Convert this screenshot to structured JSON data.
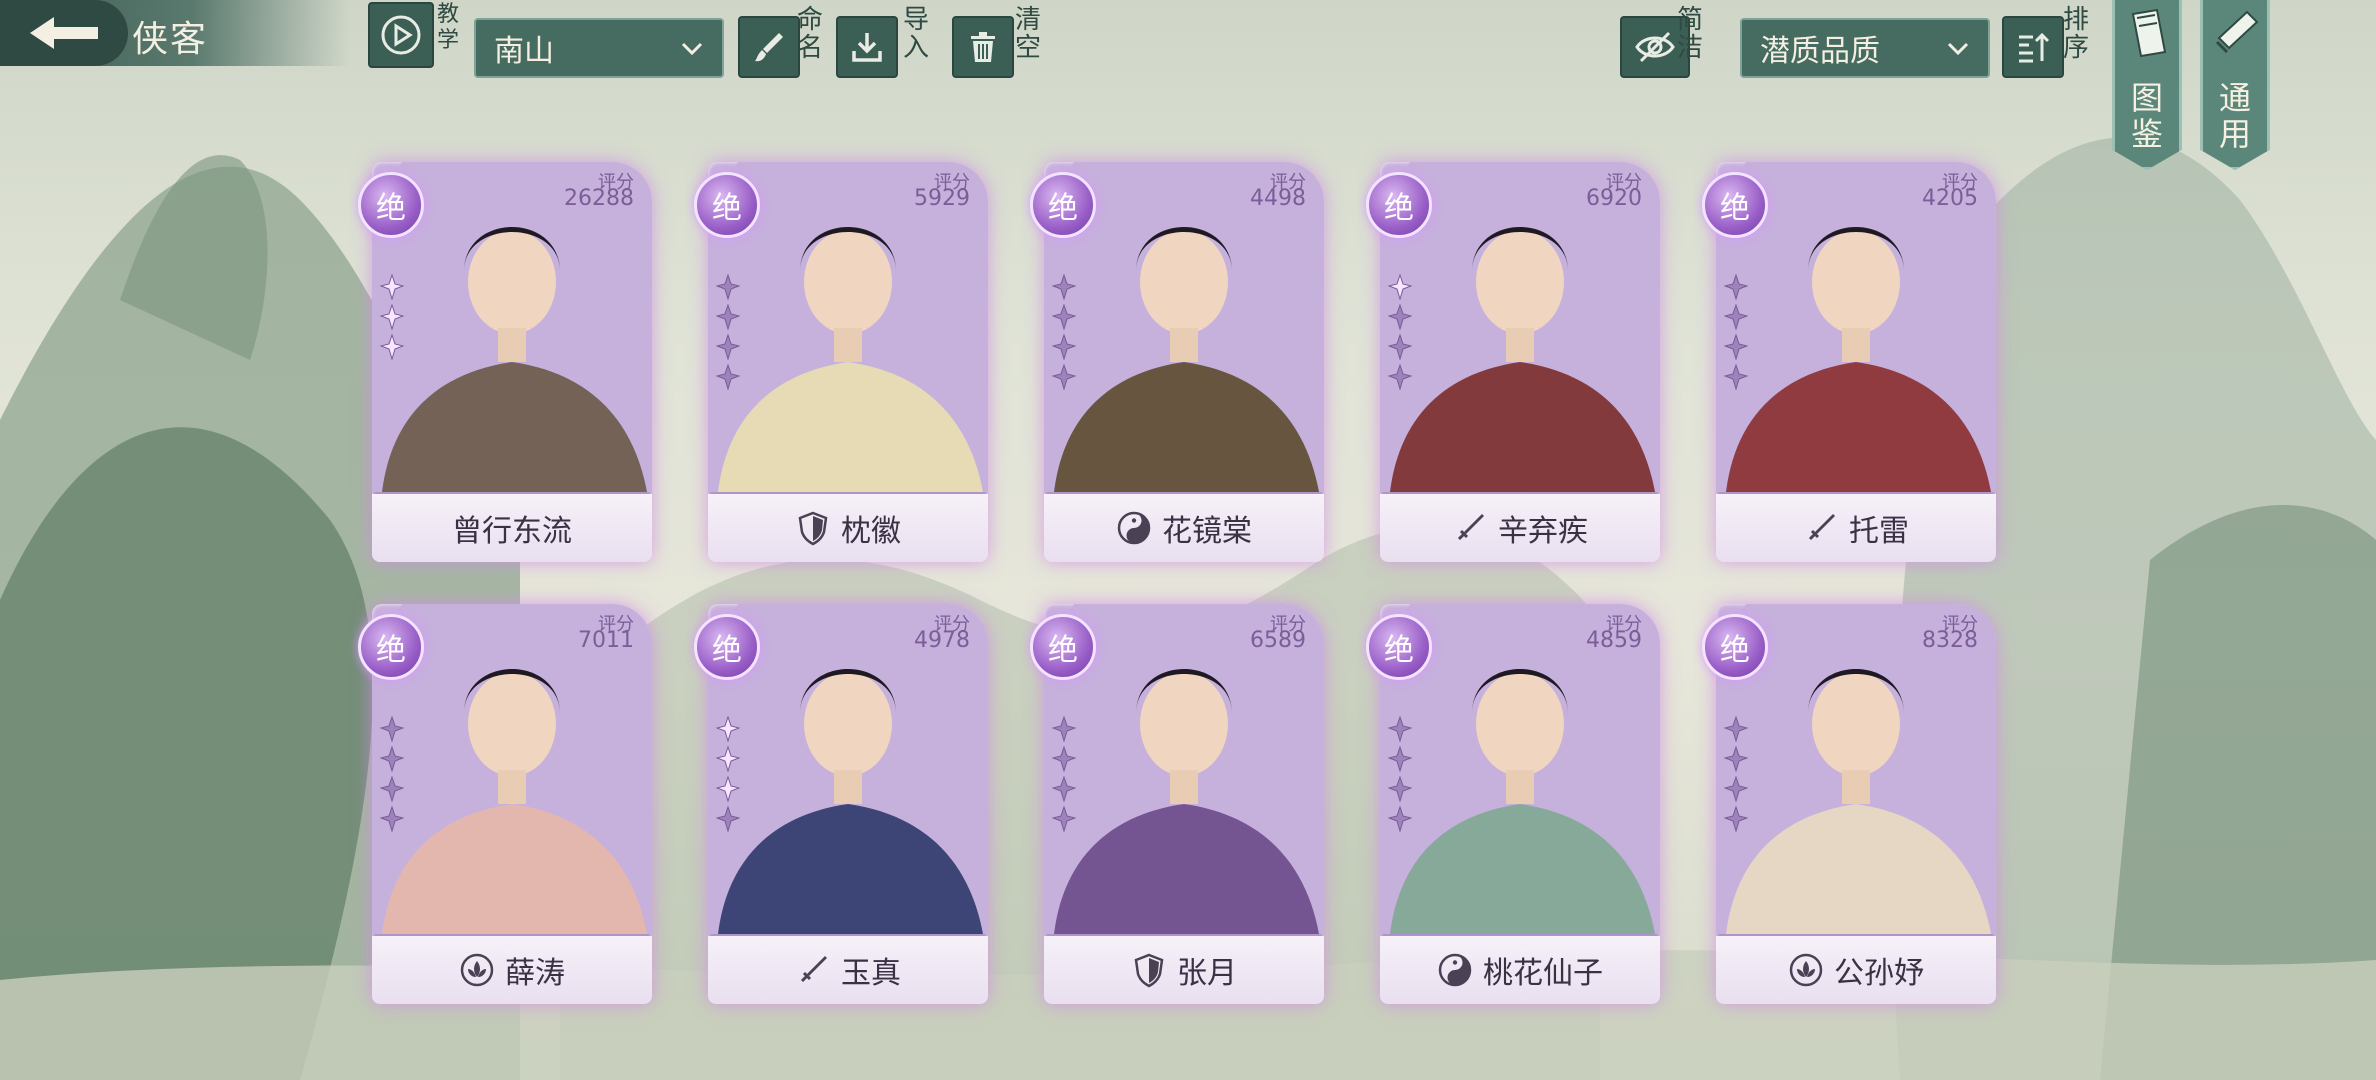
{
  "header": {
    "title": "侠客",
    "tutorial_label": "教学",
    "filter_value": "南山",
    "rename_label": "命名",
    "import_label": "导入",
    "clear_label": "清空",
    "simple_label": "简洁",
    "sort_value": "潜质品质",
    "sort_label": "排序",
    "atlas_label": "图鉴",
    "general_label": "通用"
  },
  "score_label": "评分",
  "rank_label": "绝",
  "cards": [
    {
      "name": "曾行东流",
      "score": "26288",
      "school": "none",
      "stars": 3,
      "stars_lit": 3,
      "palette": "#6b5a48"
    },
    {
      "name": "枕徽",
      "score": "5929",
      "school": "shield-icon",
      "stars": 4,
      "stars_lit": 0,
      "palette": "#e9e0b0"
    },
    {
      "name": "花镜棠",
      "score": "4498",
      "school": "yinyang-icon",
      "stars": 4,
      "stars_lit": 0,
      "palette": "#5d4b2f"
    },
    {
      "name": "辛弃疾",
      "score": "6920",
      "school": "sword-icon",
      "stars": 4,
      "stars_lit": 1,
      "palette": "#7a2e2a"
    },
    {
      "name": "托雷",
      "score": "4205",
      "school": "sword-icon",
      "stars": 4,
      "stars_lit": 0,
      "palette": "#8a2f2f"
    },
    {
      "name": "薛涛",
      "score": "7011",
      "school": "lotus-icon",
      "stars": 4,
      "stars_lit": 0,
      "palette": "#e7b8a8"
    },
    {
      "name": "玉真",
      "score": "4978",
      "school": "sword-icon",
      "stars": 4,
      "stars_lit": 3,
      "palette": "#2e3a6a"
    },
    {
      "name": "张月",
      "score": "6589",
      "school": "shield-icon",
      "stars": 4,
      "stars_lit": 0,
      "palette": "#6b4a8a"
    },
    {
      "name": "桃花仙子",
      "score": "4859",
      "school": "yinyang-icon",
      "stars": 4,
      "stars_lit": 0,
      "palette": "#7fa892"
    },
    {
      "name": "公孙妤",
      "score": "8328",
      "school": "lotus-icon",
      "stars": 4,
      "stars_lit": 0,
      "palette": "#e8dcc0"
    }
  ]
}
